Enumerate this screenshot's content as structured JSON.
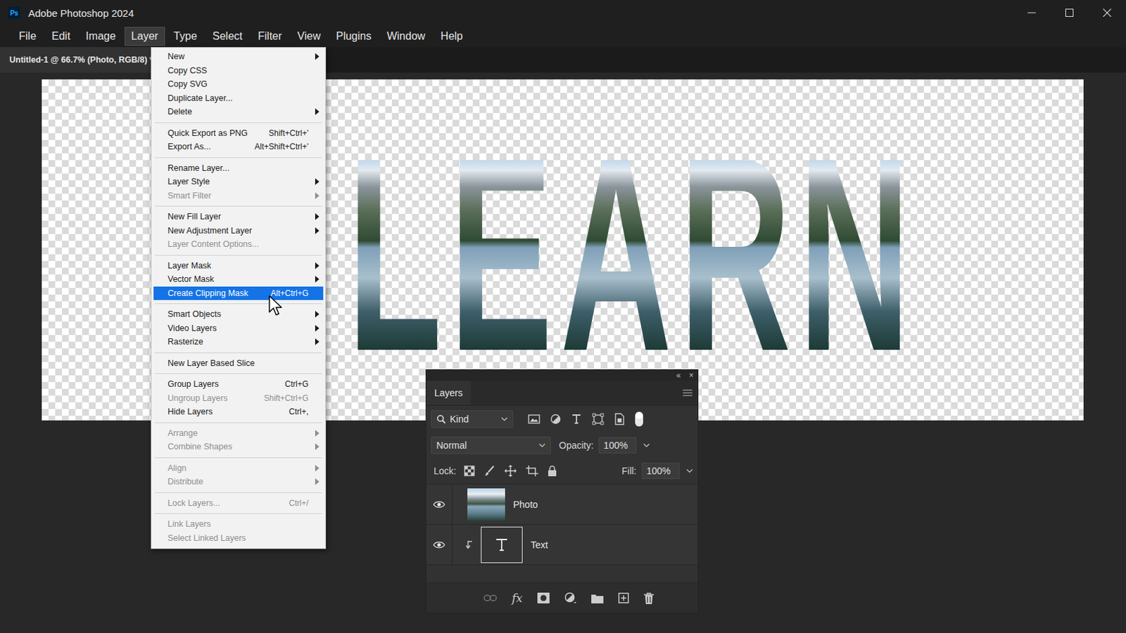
{
  "window": {
    "logo": "Ps",
    "title": "Adobe Photoshop 2024"
  },
  "menubar": [
    {
      "label": "File",
      "selected": false
    },
    {
      "label": "Edit",
      "selected": false
    },
    {
      "label": "Image",
      "selected": false
    },
    {
      "label": "Layer",
      "selected": true
    },
    {
      "label": "Type",
      "selected": false
    },
    {
      "label": "Select",
      "selected": false
    },
    {
      "label": "Filter",
      "selected": false
    },
    {
      "label": "View",
      "selected": false
    },
    {
      "label": "Plugins",
      "selected": false
    },
    {
      "label": "Window",
      "selected": false
    },
    {
      "label": "Help",
      "selected": false
    }
  ],
  "document_tab": {
    "title": "Untitled-1 @ 66.7% (Photo, RGB/8) *"
  },
  "canvas": {
    "text": "LEARN"
  },
  "layer_menu": {
    "groups": [
      {
        "items": [
          {
            "label": "New",
            "shortcut": "",
            "submenu": true,
            "disabled": false,
            "selected": false
          },
          {
            "label": "Copy CSS",
            "shortcut": "",
            "submenu": false,
            "disabled": false,
            "selected": false
          },
          {
            "label": "Copy SVG",
            "shortcut": "",
            "submenu": false,
            "disabled": false,
            "selected": false
          },
          {
            "label": "Duplicate Layer...",
            "shortcut": "",
            "submenu": false,
            "disabled": false,
            "selected": false
          },
          {
            "label": "Delete",
            "shortcut": "",
            "submenu": true,
            "disabled": false,
            "selected": false
          }
        ]
      },
      {
        "items": [
          {
            "label": "Quick Export as PNG",
            "shortcut": "Shift+Ctrl+'",
            "submenu": false,
            "disabled": false,
            "selected": false
          },
          {
            "label": "Export As...",
            "shortcut": "Alt+Shift+Ctrl+'",
            "submenu": false,
            "disabled": false,
            "selected": false
          }
        ]
      },
      {
        "items": [
          {
            "label": "Rename Layer...",
            "shortcut": "",
            "submenu": false,
            "disabled": false,
            "selected": false
          },
          {
            "label": "Layer Style",
            "shortcut": "",
            "submenu": true,
            "disabled": false,
            "selected": false
          },
          {
            "label": "Smart Filter",
            "shortcut": "",
            "submenu": true,
            "disabled": true,
            "selected": false
          }
        ]
      },
      {
        "items": [
          {
            "label": "New Fill Layer",
            "shortcut": "",
            "submenu": true,
            "disabled": false,
            "selected": false
          },
          {
            "label": "New Adjustment Layer",
            "shortcut": "",
            "submenu": true,
            "disabled": false,
            "selected": false
          },
          {
            "label": "Layer Content Options...",
            "shortcut": "",
            "submenu": false,
            "disabled": true,
            "selected": false
          }
        ]
      },
      {
        "items": [
          {
            "label": "Layer Mask",
            "shortcut": "",
            "submenu": true,
            "disabled": false,
            "selected": false
          },
          {
            "label": "Vector Mask",
            "shortcut": "",
            "submenu": true,
            "disabled": false,
            "selected": false
          },
          {
            "label": "Create Clipping Mask",
            "shortcut": "Alt+Ctrl+G",
            "submenu": false,
            "disabled": false,
            "selected": true
          }
        ]
      },
      {
        "items": [
          {
            "label": "Smart Objects",
            "shortcut": "",
            "submenu": true,
            "disabled": false,
            "selected": false
          },
          {
            "label": "Video Layers",
            "shortcut": "",
            "submenu": true,
            "disabled": false,
            "selected": false
          },
          {
            "label": "Rasterize",
            "shortcut": "",
            "submenu": true,
            "disabled": false,
            "selected": false
          }
        ]
      },
      {
        "items": [
          {
            "label": "New Layer Based Slice",
            "shortcut": "",
            "submenu": false,
            "disabled": false,
            "selected": false
          }
        ]
      },
      {
        "items": [
          {
            "label": "Group Layers",
            "shortcut": "Ctrl+G",
            "submenu": false,
            "disabled": false,
            "selected": false
          },
          {
            "label": "Ungroup Layers",
            "shortcut": "Shift+Ctrl+G",
            "submenu": false,
            "disabled": true,
            "selected": false
          },
          {
            "label": "Hide Layers",
            "shortcut": "Ctrl+,",
            "submenu": false,
            "disabled": false,
            "selected": false
          }
        ]
      },
      {
        "items": [
          {
            "label": "Arrange",
            "shortcut": "",
            "submenu": true,
            "disabled": true,
            "selected": false
          },
          {
            "label": "Combine Shapes",
            "shortcut": "",
            "submenu": true,
            "disabled": true,
            "selected": false
          }
        ]
      },
      {
        "items": [
          {
            "label": "Align",
            "shortcut": "",
            "submenu": true,
            "disabled": true,
            "selected": false
          },
          {
            "label": "Distribute",
            "shortcut": "",
            "submenu": true,
            "disabled": true,
            "selected": false
          }
        ]
      },
      {
        "items": [
          {
            "label": "Lock Layers...",
            "shortcut": "Ctrl+/",
            "submenu": false,
            "disabled": true,
            "selected": false
          }
        ]
      },
      {
        "items": [
          {
            "label": "Link Layers",
            "shortcut": "",
            "submenu": false,
            "disabled": true,
            "selected": false
          },
          {
            "label": "Select Linked Layers",
            "shortcut": "",
            "submenu": false,
            "disabled": true,
            "selected": false
          }
        ]
      }
    ]
  },
  "layers_panel": {
    "title": "Layers",
    "collapse": "«",
    "close": "×",
    "filter": "Kind",
    "blend_mode": "Normal",
    "opacity_label": "Opacity:",
    "opacity": "100%",
    "lock_label": "Lock:",
    "fill_label": "Fill:",
    "fill": "100%",
    "layers": [
      {
        "name": "Photo",
        "visible": true,
        "kind": "image",
        "clipped": false
      },
      {
        "name": "Text",
        "visible": true,
        "kind": "text",
        "clipped": true
      }
    ],
    "fx_label": "fx"
  }
}
